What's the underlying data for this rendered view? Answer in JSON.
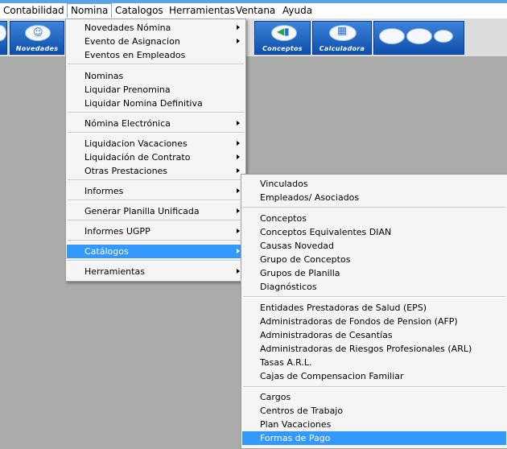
{
  "menubar": {
    "items": [
      "Contabilidad",
      "Nomina",
      "Catalogos",
      "Herramientas",
      "Ventana",
      "Ayuda"
    ]
  },
  "toolbar": {
    "novedades_label": "Novedades",
    "conceptos_label": "Conceptos",
    "calculadora_label": "Calculadora"
  },
  "nomina_menu": {
    "items": [
      "Novedades Nómina",
      "Evento de Asignacion",
      "Eventos en Empleados",
      "Nominas",
      "Liquidar Prenomina",
      "Liquidar Nomina Definitiva",
      "Nómina Electrónica",
      "Liquidacion Vacaciones",
      "Liquidación de Contrato",
      "Otras Prestaciones",
      "Informes",
      "Generar Planilla Unificada",
      "Informes UGPP",
      "Catálogos",
      "Herramientas"
    ]
  },
  "catalogos_submenu": {
    "items": [
      "Vinculados",
      "Empleados/ Asociados",
      "Conceptos",
      "Conceptos Equivalentes DIAN",
      "Causas Novedad",
      "Grupo de Conceptos",
      "Grupos de Planilla",
      "Diagnósticos",
      "Entidades Prestadoras de Salud (EPS)",
      "Administradoras de Fondos de Pension (AFP)",
      "Administradoras de Cesantías",
      "Administradoras de Riesgos Profesionales (ARL)",
      "Tasas A.R.L.",
      "Cajas de Compensacion Familiar",
      "Cargos",
      "Centros de Trabajo",
      "Plan Vacaciones",
      "Formas de Pago"
    ]
  },
  "colors": {
    "selection": "#3399ff",
    "toolbar_button": "#1f63c2",
    "workspace": "#ababab"
  }
}
